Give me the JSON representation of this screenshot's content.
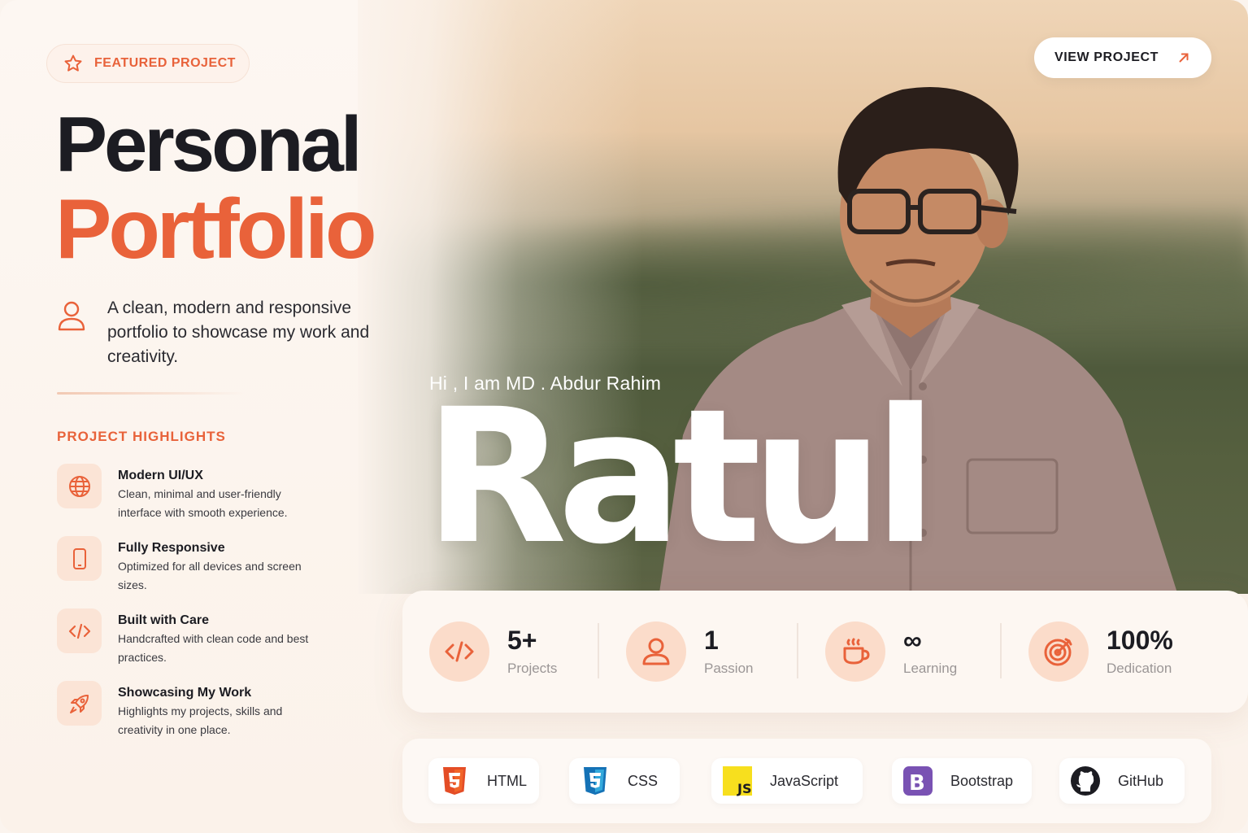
{
  "header": {
    "badge_label": "FEATURED PROJECT",
    "title_line1": "Personal",
    "title_line2": "Portfolio",
    "description": "A clean, modern and responsive portfolio to showcase my work and creativity.",
    "view_project_label": "VIEW PROJECT"
  },
  "hero": {
    "greeting": "Hi , I am MD . Abdur Rahim",
    "name": "Ratul"
  },
  "highlights": {
    "title": "PROJECT HIGHLIGHTS",
    "items": [
      {
        "icon": "globe-icon",
        "title": "Modern UI/UX",
        "desc": "Clean, minimal and user-friendly interface with smooth experience."
      },
      {
        "icon": "mobile-icon",
        "title": "Fully Responsive",
        "desc": "Optimized for all devices and screen sizes."
      },
      {
        "icon": "code-icon",
        "title": "Built with Care",
        "desc": "Handcrafted with clean code and best practices."
      },
      {
        "icon": "rocket-icon",
        "title": "Showcasing My Work",
        "desc": "Highlights my projects, skills and creativity in one place."
      }
    ]
  },
  "stats": [
    {
      "icon": "code-icon",
      "value": "5+",
      "label": "Projects"
    },
    {
      "icon": "user-icon",
      "value": "1",
      "label": "Passion"
    },
    {
      "icon": "coffee-icon",
      "value": "∞",
      "label": "Learning"
    },
    {
      "icon": "target-icon",
      "value": "100%",
      "label": "Dedication"
    }
  ],
  "tech": [
    {
      "icon": "html5-icon",
      "label": "HTML"
    },
    {
      "icon": "css3-icon",
      "label": "CSS"
    },
    {
      "icon": "javascript-icon",
      "label": "JavaScript"
    },
    {
      "icon": "bootstrap-icon",
      "label": "Bootstrap"
    },
    {
      "icon": "github-icon",
      "label": "GitHub"
    }
  ],
  "colors": {
    "accent": "#e9623a",
    "accent_soft": "#fbe4d6",
    "text_dark": "#1c1c22",
    "muted": "#9b9696"
  }
}
